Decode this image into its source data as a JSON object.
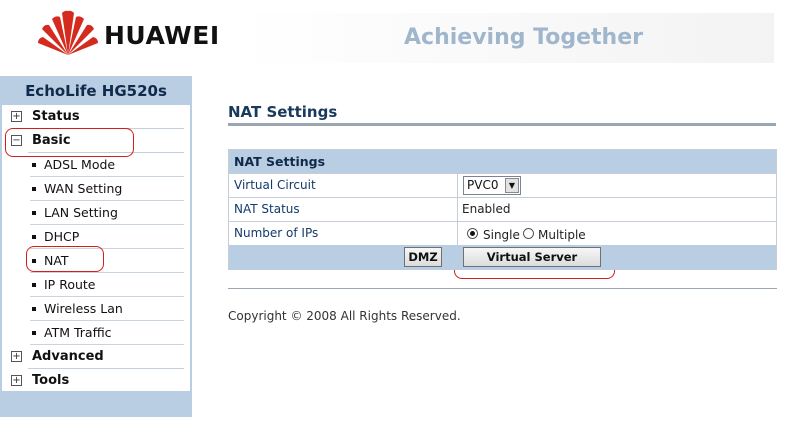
{
  "header": {
    "brand": "HUAWEI",
    "tagline": "Achieving Together",
    "logo_color": "#d52b1e"
  },
  "sidebar": {
    "device_name": "EchoLife HG520s",
    "items": [
      {
        "label": "Status",
        "expanded": false,
        "icon": "plus-icon"
      },
      {
        "label": "Basic",
        "expanded": true,
        "icon": "minus-icon",
        "children": [
          "ADSL Mode",
          "WAN Setting",
          "LAN Setting",
          "DHCP",
          "NAT",
          "IP Route",
          "Wireless Lan",
          "ATM Traffic"
        ]
      },
      {
        "label": "Advanced",
        "expanded": false,
        "icon": "plus-icon"
      },
      {
        "label": "Tools",
        "expanded": false,
        "icon": "plus-icon"
      }
    ]
  },
  "main": {
    "page_title": "NAT Settings",
    "panel": {
      "header": "NAT Settings",
      "rows": [
        {
          "label": "Virtual Circuit",
          "value": "PVC0"
        },
        {
          "label": "NAT Status",
          "value": "Enabled"
        },
        {
          "label": "Number of IPs",
          "options": [
            "Single",
            "Multiple"
          ],
          "selected": "Single"
        }
      ],
      "buttons": {
        "dmz": "DMZ",
        "virtual_server": "Virtual Server"
      }
    },
    "copyright": "Copyright © 2008 All Rights Reserved."
  },
  "colors": {
    "accent": "#b9cde3",
    "title": "#183a5c",
    "annotation": "#d0201c"
  }
}
